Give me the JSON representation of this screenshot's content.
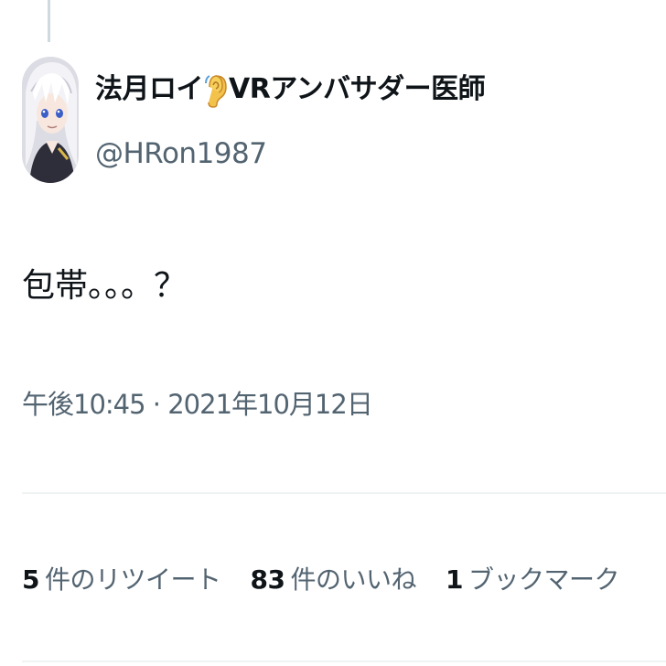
{
  "tweet": {
    "author": {
      "name_prefix": "法月ロイ",
      "name_suffix": "VRアンバサダー医師",
      "emoji": "ear",
      "handle": "@HRon1987"
    },
    "text": "包帯。。。？",
    "timestamp": "午後10:45 · 2021年10月12日"
  },
  "stats": [
    {
      "value": "5",
      "label": "件のリツイート"
    },
    {
      "value": "83",
      "label": "件のいいね"
    },
    {
      "value": "1",
      "label": "ブックマーク"
    }
  ],
  "colors": {
    "text": "#0f1419",
    "secondary": "#536471",
    "divider": "#eff3f4",
    "thread_line": "#cfd9de"
  }
}
